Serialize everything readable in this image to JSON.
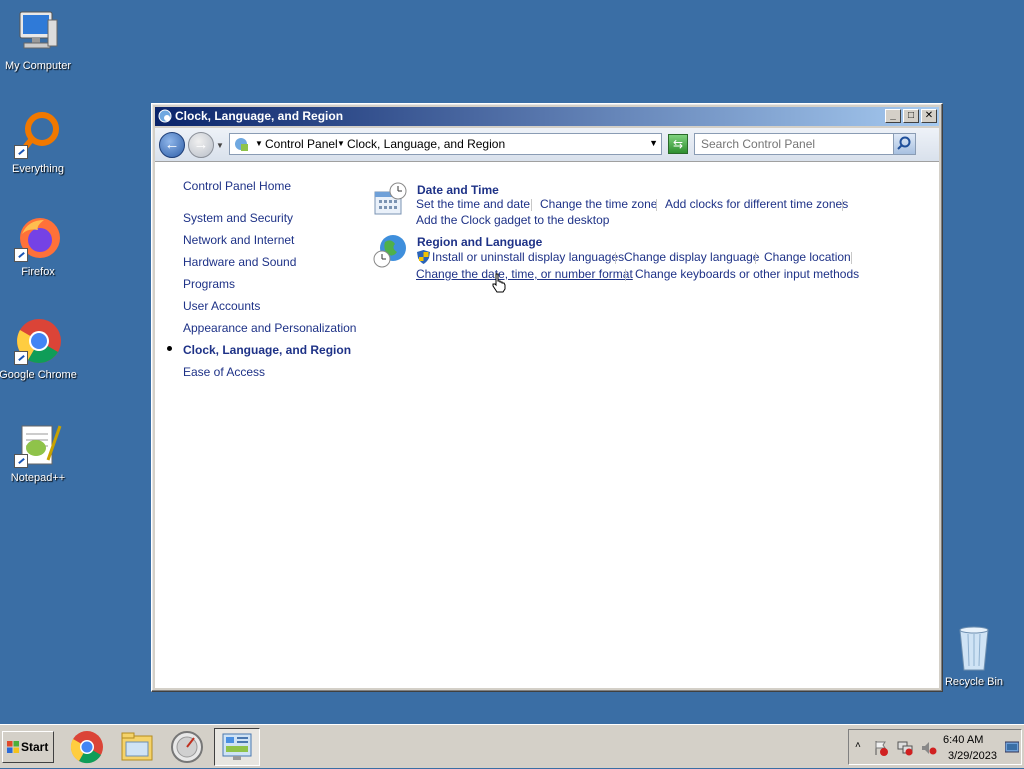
{
  "desktop": {
    "icons": [
      {
        "label": "My Computer",
        "icon": "computer-icon"
      },
      {
        "label": "Everything",
        "icon": "everything-icon"
      },
      {
        "label": "Firefox",
        "icon": "firefox-icon"
      },
      {
        "label": "Google Chrome",
        "icon": "chrome-icon"
      },
      {
        "label": "Notepad++",
        "icon": "notepadpp-icon"
      },
      {
        "label": "Recycle Bin",
        "icon": "recycle-bin-icon"
      }
    ]
  },
  "window": {
    "title": "Clock, Language, and Region",
    "controls": {
      "minimize": "_",
      "maximize": "□",
      "close": "✕"
    },
    "address": {
      "crumbs": [
        "Control Panel",
        "Clock, Language, and Region"
      ]
    },
    "search": {
      "placeholder": "Search Control Panel"
    },
    "nav": {
      "home": "Control Panel Home",
      "items": [
        "System and Security",
        "Network and Internet",
        "Hardware and Sound",
        "Programs",
        "User Accounts",
        "Appearance and Personalization",
        "Clock, Language, and Region",
        "Ease of Access"
      ],
      "active_index": 6
    },
    "categories": [
      {
        "title": "Date and Time",
        "icon": "calendar-clock-icon",
        "tasks": [
          "Set the time and date",
          "Change the time zone",
          "Add clocks for different time zones",
          "Add the Clock gadget to the desktop"
        ]
      },
      {
        "title": "Region and Language",
        "icon": "globe-clock-icon",
        "tasks": [
          "Install or uninstall display languages",
          "Change display language",
          "Change location",
          "Change the date, time, or number format",
          "Change keyboards or other input methods"
        ]
      }
    ]
  },
  "taskbar": {
    "start_label": "Start",
    "apps": [
      "chrome-icon",
      "explorer-icon",
      "utility-icon",
      "control-panel-icon"
    ],
    "tray": {
      "time": "6:40 AM",
      "date": "3/29/2023"
    },
    "colors": {
      "desktop": "#3a6ea5",
      "link": "#1e3287",
      "title_start": "#0a246a",
      "title_end": "#a6caf0"
    }
  }
}
